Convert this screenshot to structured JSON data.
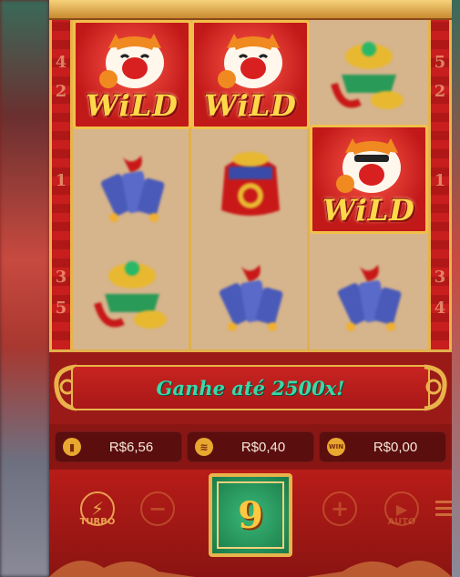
{
  "pillar_numbers": {
    "left": [
      "4",
      "2",
      "1",
      "3",
      "5"
    ],
    "right": [
      "5",
      "2",
      "1",
      "3",
      "4"
    ]
  },
  "reels": [
    [
      "wild",
      "firecracker",
      "gold-ingot"
    ],
    [
      "wild",
      "red-envelope",
      "firecracker"
    ],
    [
      "gold-ingot",
      "wild",
      "firecracker"
    ]
  ],
  "wild_label": "WiLD",
  "banner": {
    "text": "Ganhe até 2500x!"
  },
  "info": {
    "balance": "R$6,56",
    "bet": "R$0,40",
    "win": "R$0,00",
    "win_icon_text": "WIN"
  },
  "controls": {
    "turbo_label": "TURBO",
    "minus_label": "−",
    "plus_label": "+",
    "auto_label": "AUTO",
    "spin_count": "9"
  },
  "colors": {
    "frame_red": "#7a1614",
    "gold": "#e9b34a",
    "banner_text": "#3ad8a8",
    "spin_green": "#2a9a60"
  }
}
